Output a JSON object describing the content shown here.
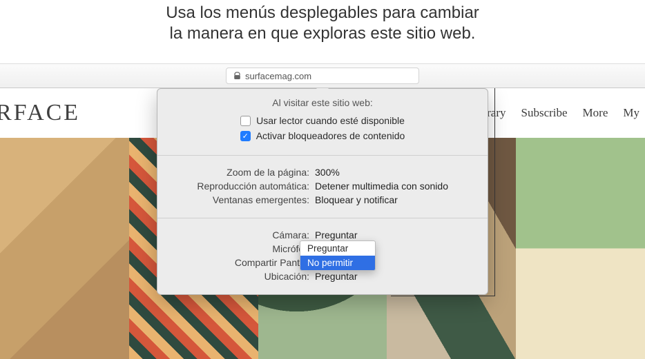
{
  "caption": {
    "line1": "Usa los menús desplegables para cambiar",
    "line2": "la manera en que exploras este sitio web."
  },
  "address_bar": {
    "domain": "surfacemag.com"
  },
  "site_nav": {
    "logo": "RFACE",
    "links": [
      "rary",
      "Subscribe",
      "More",
      "My"
    ]
  },
  "popover": {
    "title": "Al visitar este sitio web:",
    "reader": {
      "label": "Usar lector cuando esté disponible",
      "checked": false
    },
    "blockers": {
      "label": "Activar bloqueadores de contenido",
      "checked": true
    },
    "zoom": {
      "label": "Zoom de la página:",
      "value": "300%"
    },
    "autoplay": {
      "label": "Reproducción automática:",
      "value": "Detener multimedia con sonido"
    },
    "popups": {
      "label": "Ventanas emergentes:",
      "value": "Bloquear y notificar"
    },
    "camera": {
      "label": "Cámara:",
      "value": "Preguntar"
    },
    "mic": {
      "label": "Micrófon",
      "value": ""
    },
    "screen": {
      "label": "Compartir Pantall",
      "value": ""
    },
    "location": {
      "label": "Ubicación:",
      "value": "Preguntar"
    }
  },
  "dropdown": {
    "options": [
      "Preguntar",
      "No permitir"
    ],
    "selected_index": 1
  }
}
